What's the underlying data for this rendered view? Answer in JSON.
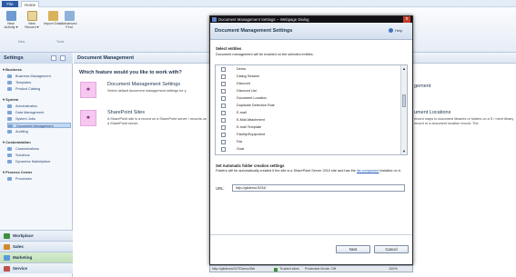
{
  "ribbon": {
    "tabs": [
      "File",
      "Home"
    ],
    "buttons": [
      {
        "label": "New Activity ▾",
        "icon": "new-activity-icon"
      },
      {
        "label": "New Record ▾",
        "icon": "new-record-icon"
      },
      {
        "label": "Import Data",
        "icon": "import-data-icon"
      },
      {
        "label": "Advanced Find",
        "icon": "advanced-find-icon"
      }
    ],
    "groups": [
      "New",
      "Tools"
    ]
  },
  "left_nav": {
    "title": "Settings",
    "sections": [
      {
        "label": "▾ Business",
        "items": [
          "Business Management",
          "Templates",
          "Product Catalog"
        ]
      },
      {
        "label": "▾ System",
        "items": [
          "Administration",
          "Data Management",
          "System Jobs",
          "Document Management",
          "Auditing"
        ]
      },
      {
        "label": "▾ Customization",
        "items": [
          "Customizations",
          "Solutions",
          "Dynamics Marketplace"
        ]
      },
      {
        "label": "▾ Process Center",
        "items": [
          "Processes"
        ]
      }
    ],
    "selected": "Document Management",
    "areas": [
      "Workplace",
      "Sales",
      "Marketing",
      "Service"
    ]
  },
  "main": {
    "header": "Document Management",
    "question": "Which feature would you like to work with?",
    "features": [
      {
        "title": "Document Management Settings",
        "desc": "Select default document management settings for y"
      },
      {
        "title": "SharePoint Sites",
        "desc": "A SharePoint site is a record on a SharePoint server / records on a SharePoint server."
      }
    ],
    "right_features": [
      {
        "title": "gement",
        "desc": ""
      },
      {
        "title": "ument Locations",
        "desc": "record maps to document libraries or folders on a S / ment library record or a document location record. The"
      }
    ]
  },
  "dialog": {
    "titlebar": "Document Management Settings -- Webpage Dialog",
    "close": "x",
    "title": "Document Management Settings",
    "help": "Help",
    "select_entities": "Select entities",
    "select_desc": "Document management will be enabled on the selected entities.",
    "entities": [
      "Demo",
      "Dialog Session",
      "Discount",
      "Discount List",
      "Document Location",
      "Duplicate Detection Rule",
      "E-mail",
      "E-Mail Attachment",
      "E-mail Template",
      "Facility/Equipment",
      "Fax",
      "Goal"
    ],
    "folder_title": "Set Automatic folder creation settings",
    "folder_desc_1": "Folders will be automatically created if the site is a SharePoint Server 2010 site and has the",
    "folder_link": "list component",
    "folder_desc_2": "installed on it.",
    "url_label": "URL:",
    "url_value": "http://gitdemo:5234/",
    "next": "Next",
    "cancel": "Cancel",
    "status_url": "http://gitdemo/GITDemo/We",
    "status_trusted": "Trusted sites",
    "status_mode": "Protected Mode: Off",
    "zoom": "100%"
  },
  "colors": {
    "accent": "#2b5aa7",
    "feature_icon": "#f6c7ef",
    "dialog_titlebar": "#0f0f14"
  }
}
